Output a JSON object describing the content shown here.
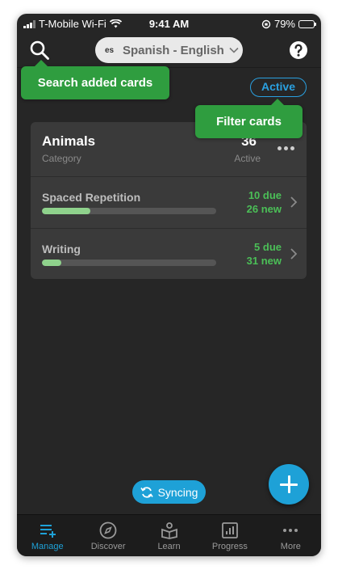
{
  "status_bar": {
    "carrier": "T-Mobile Wi-Fi",
    "time": "9:41 AM",
    "battery": "79%"
  },
  "header": {
    "language_code": "es",
    "language_pair": "Spanish - English"
  },
  "filter": {
    "label": "Active"
  },
  "tooltips": {
    "search": "Search added cards",
    "filter": "Filter cards"
  },
  "category_card": {
    "title": "Animals",
    "subtitle": "Category",
    "count": "36",
    "count_label": "Active",
    "rows": [
      {
        "label": "Spaced Repetition",
        "due": "10 due",
        "new": "26 new",
        "progress": 0.28
      },
      {
        "label": "Writing",
        "due": "5 due",
        "new": "31 new",
        "progress": 0.11
      }
    ]
  },
  "sync": {
    "label": "Syncing"
  },
  "tabs": [
    {
      "label": "Manage",
      "icon": "manage-icon",
      "active": true
    },
    {
      "label": "Discover",
      "icon": "compass-icon",
      "active": false
    },
    {
      "label": "Learn",
      "icon": "learn-icon",
      "active": false
    },
    {
      "label": "Progress",
      "icon": "progress-icon",
      "active": false
    },
    {
      "label": "More",
      "icon": "more-icon",
      "active": false
    }
  ],
  "colors": {
    "accent": "#1ea1d7",
    "success": "#4bbf57",
    "tooltip": "#2f9d3f"
  }
}
